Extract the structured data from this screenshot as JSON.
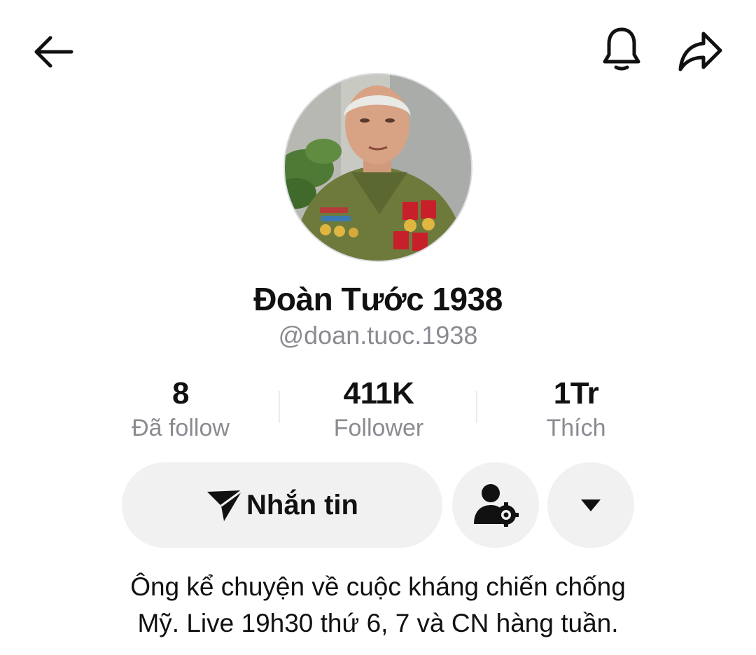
{
  "header": {
    "back_icon": "arrow-left-icon",
    "bell_icon": "bell-icon",
    "share_icon": "share-arrow-icon"
  },
  "profile": {
    "display_name": "Đoàn Tước 1938",
    "username": "@doan.tuoc.1938",
    "avatar": "elderly-veteran-in-green-uniform-with-medals"
  },
  "stats": [
    {
      "value": "8",
      "label": "Đã follow"
    },
    {
      "value": "411K",
      "label": "Follower"
    },
    {
      "value": "1Tr",
      "label": "Thích"
    }
  ],
  "actions": {
    "message_label": "Nhắn tin",
    "message_icon": "paper-plane-icon",
    "friends_icon": "user-settings-icon",
    "more_icon": "caret-down-icon"
  },
  "bio": {
    "line1": "Ông kể chuyện về cuộc kháng chiến chống",
    "line2": "Mỹ. Live 19h30 thứ 6, 7 và CN hàng tuần."
  },
  "colors": {
    "text_primary": "#111111",
    "text_secondary": "#8a8b91",
    "button_bg": "#f1f1f2"
  }
}
